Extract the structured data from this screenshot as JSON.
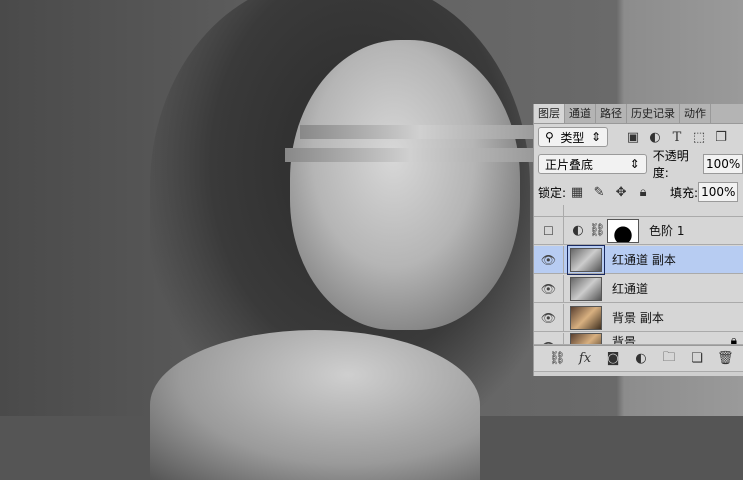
{
  "tabs": [
    {
      "label": "图层"
    },
    {
      "label": "通道"
    },
    {
      "label": "路径"
    },
    {
      "label": "历史记录"
    },
    {
      "label": "动作"
    }
  ],
  "filter": {
    "label": "类型",
    "icons": [
      "image-filter-icon",
      "adjustment-filter-icon",
      "type-filter-icon",
      "shape-filter-icon",
      "smart-object-filter-icon"
    ]
  },
  "blend": {
    "mode": "正片叠底",
    "opacity_label": "不透明度:",
    "opacity": "100%"
  },
  "lock": {
    "label": "锁定:",
    "fill_label": "填充:",
    "fill": "100%"
  },
  "layers": [
    {
      "name": "色阶 1",
      "visible": false
    },
    {
      "name": "红通道 副本",
      "visible": true,
      "selected": true
    },
    {
      "name": "红通道",
      "visible": true
    },
    {
      "name": "背景 副本",
      "visible": true
    },
    {
      "name": "背景",
      "visible": true,
      "locked": true
    }
  ]
}
